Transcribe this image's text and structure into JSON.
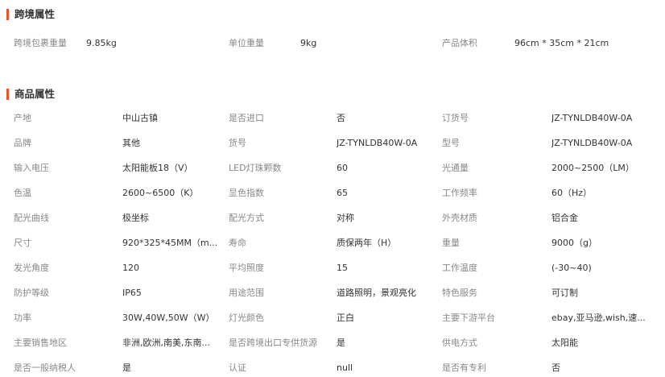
{
  "cross_border": {
    "title": "跨境属性",
    "items": [
      {
        "label": "跨境包裹重量",
        "value": "9.85kg"
      },
      {
        "label": "单位重量",
        "value": "9kg"
      },
      {
        "label": "产品体积",
        "value": "96cm * 35cm * 21cm"
      }
    ]
  },
  "product": {
    "title": "商品属性",
    "rows": [
      [
        {
          "label": "产地",
          "value": "中山古镇"
        },
        {
          "label": "是否进口",
          "value": "否"
        },
        {
          "label": "订货号",
          "value": "JZ-TYNLDB40W-0A"
        }
      ],
      [
        {
          "label": "品牌",
          "value": "其他"
        },
        {
          "label": "货号",
          "value": "JZ-TYNLDB40W-0A"
        },
        {
          "label": "型号",
          "value": "JZ-TYNLDB40W-0A"
        }
      ],
      [
        {
          "label": "输入电压",
          "value": "太阳能板18（V）"
        },
        {
          "label": "LED灯珠颗数",
          "value": "60"
        },
        {
          "label": "光通量",
          "value": "2000~2500（LM）"
        }
      ],
      [
        {
          "label": "色温",
          "value": "2600~6500（K）"
        },
        {
          "label": "显色指数",
          "value": "65"
        },
        {
          "label": "工作频率",
          "value": "60（Hz）"
        }
      ],
      [
        {
          "label": "配光曲线",
          "value": "极坐标"
        },
        {
          "label": "配光方式",
          "value": "对称"
        },
        {
          "label": "外壳材质",
          "value": "铝合金"
        }
      ],
      [
        {
          "label": "尺寸",
          "value": "920*325*45MM（m..."
        },
        {
          "label": "寿命",
          "value": "质保两年（H）"
        },
        {
          "label": "重量",
          "value": "9000（g）"
        }
      ],
      [
        {
          "label": "发光角度",
          "value": "120"
        },
        {
          "label": "平均照度",
          "value": "15"
        },
        {
          "label": "工作温度",
          "value": "(-30~40)"
        }
      ],
      [
        {
          "label": "防护等级",
          "value": "IP65"
        },
        {
          "label": "用途范围",
          "value": "道路照明，景观亮化"
        },
        {
          "label": "特色服务",
          "value": "可订制"
        }
      ],
      [
        {
          "label": "功率",
          "value": "30W,40W,50W（W）"
        },
        {
          "label": "灯光颜色",
          "value": "正白"
        },
        {
          "label": "主要下游平台",
          "value": "ebay,亚马逊,wish,速..."
        }
      ],
      [
        {
          "label": "主要销售地区",
          "value": "非洲,欧洲,南美,东南..."
        },
        {
          "label": "是否跨境出口专供货源",
          "value": "是"
        },
        {
          "label": "供电方式",
          "value": "太阳能"
        }
      ],
      [
        {
          "label": "是否一般纳税人",
          "value": "是"
        },
        {
          "label": "认证",
          "value": "null"
        },
        {
          "label": "是否有专利",
          "value": "否"
        }
      ]
    ]
  }
}
